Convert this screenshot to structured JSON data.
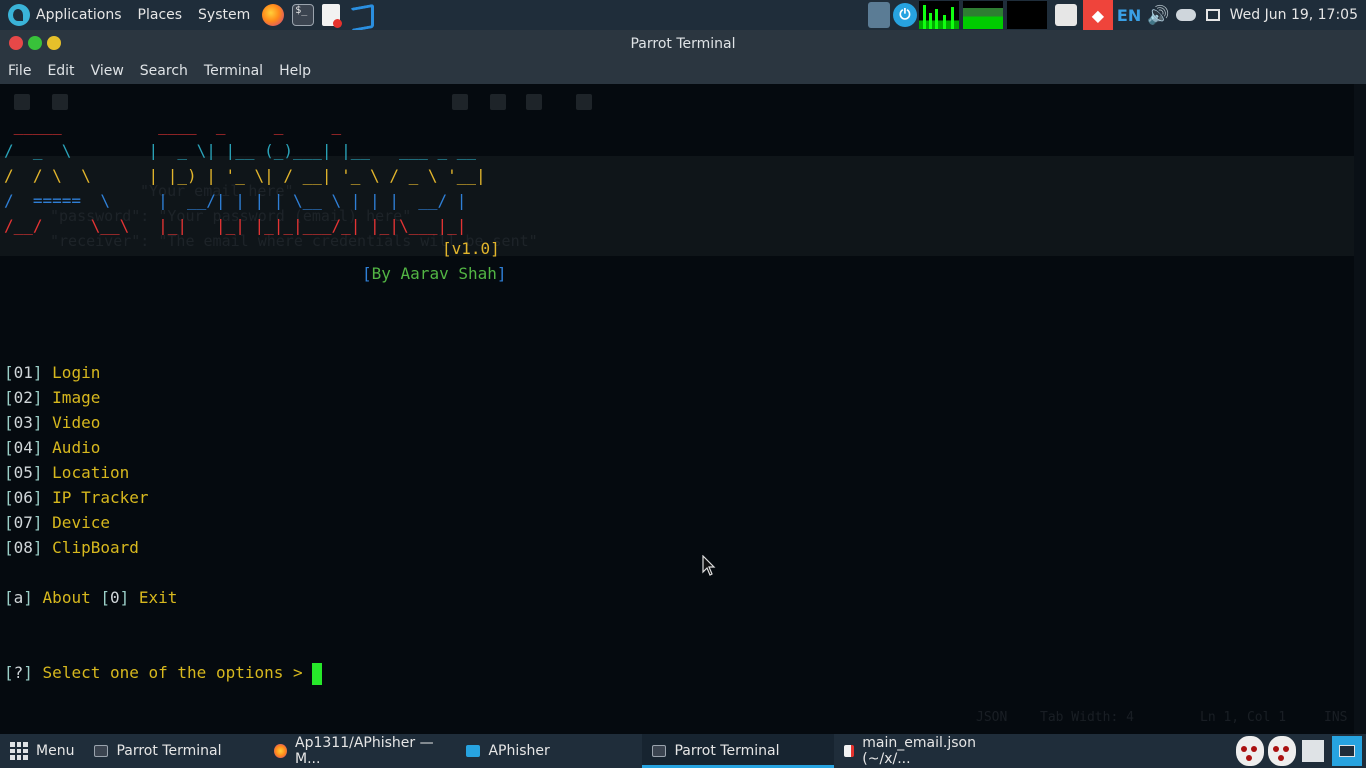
{
  "top_panel": {
    "applications": "Applications",
    "places": "Places",
    "system": "System",
    "tray_lang": "EN",
    "clock": "Wed Jun 19, 17:05"
  },
  "window": {
    "title": "Parrot Terminal",
    "menu": [
      "File",
      "Edit",
      "View",
      "Search",
      "Terminal",
      "Help"
    ]
  },
  "terminal": {
    "banner": {
      "r1": " _____          ____  _     _     _",
      "r2": "/  _  \\        |  _ \\| |__ (_)___| |__   ___ _ __",
      "r3": "/  / \\  \\      | |_) | '_ \\| / __| '_ \\ / _ \\ '__|",
      "r4": "/  =====  \\     |  __/| | | | \\__ \\ | | |  __/ |",
      "r5": "/__/     \\__\\   |_|   |_| |_|_|___/_| |_|\\___|_|",
      "version": "[v1.0]",
      "author_open": "[",
      "author": "By Aarav Shah",
      "author_close": "]"
    },
    "options": [
      {
        "num": "01",
        "label": "Login"
      },
      {
        "num": "02",
        "label": "Image"
      },
      {
        "num": "03",
        "label": "Video"
      },
      {
        "num": "04",
        "label": "Audio"
      },
      {
        "num": "05",
        "label": "Location"
      },
      {
        "num": "06",
        "label": "IP Tracker"
      },
      {
        "num": "07",
        "label": "Device"
      },
      {
        "num": "08",
        "label": "ClipBoard"
      }
    ],
    "about_key": "a",
    "about_label": "About",
    "exit_key": "0",
    "exit_label": "Exit",
    "prompt_key": "?",
    "prompt": "Select one of the options > "
  },
  "ghost_editor": {
    "l1": "\"Your email here\"",
    "l2": "\"password\": \"Your password (email) here\"",
    "l3": "\"receiver\": \"The email where credentials will be sent\"",
    "status_lang": "JSON",
    "status_tab": "Tab Width: 4",
    "status_pos": "Ln 1, Col 1",
    "status_ins": "INS"
  },
  "bottom_panel": {
    "menu": "Menu",
    "tasks": [
      {
        "label": "Parrot Terminal",
        "icon": "terminal-icon"
      },
      {
        "label": "Ap1311/APhisher — M...",
        "icon": "firefox-icon"
      },
      {
        "label": "APhisher",
        "icon": "folder-icon"
      },
      {
        "label": "Parrot Terminal",
        "icon": "terminal-icon"
      },
      {
        "label": "main_email.json (~/x/...",
        "icon": "document-icon"
      }
    ]
  },
  "colors": {
    "panel_bg": "#1f2d3a",
    "terminal_bg": "#050a0f",
    "option_yellow": "#d7b81e",
    "cursor_green": "#27e82a",
    "accent_blue": "#27a3e0"
  }
}
